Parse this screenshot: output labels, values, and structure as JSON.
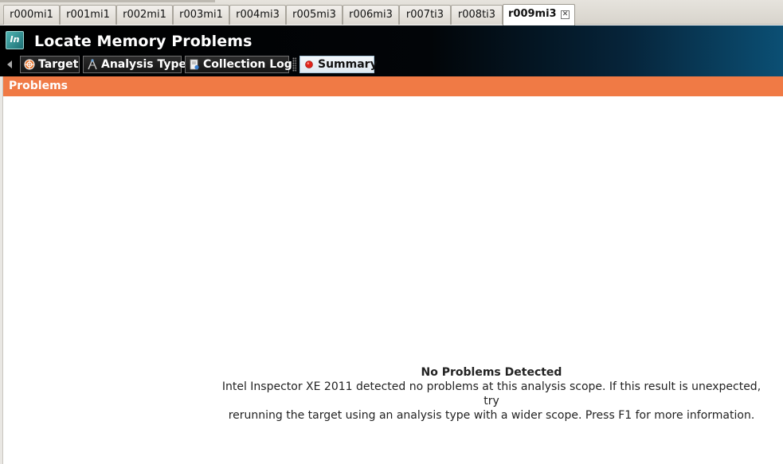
{
  "tabs": [
    {
      "label": "r000mi1"
    },
    {
      "label": "r001mi1"
    },
    {
      "label": "r002mi1"
    },
    {
      "label": "r003mi1"
    },
    {
      "label": "r004mi3"
    },
    {
      "label": "r005mi3"
    },
    {
      "label": "r006mi3"
    },
    {
      "label": "r007ti3"
    },
    {
      "label": "r008ti3"
    },
    {
      "label": "r009mi3",
      "active": true
    }
  ],
  "header": {
    "logo_text": "In",
    "title": "Locate Memory Problems"
  },
  "nav": {
    "items": [
      {
        "label": "Target",
        "icon": "target-icon"
      },
      {
        "label": "Analysis Type",
        "icon": "analysis-type-icon"
      },
      {
        "label": "Collection Log",
        "icon": "collection-log-icon"
      },
      {
        "label": "Summary",
        "icon": "red-dot-icon",
        "active": true
      }
    ]
  },
  "problems": {
    "heading": "Problems",
    "empty_title": "No Problems Detected",
    "empty_message_line1": "Intel Inspector XE 2011 detected no problems at this analysis scope. If this result is unexpected, try",
    "empty_message_line2": "rerunning the target using an analysis type with a wider scope. Press F1 for more information."
  },
  "colors": {
    "problems_bar": "#f07a45",
    "header_dark": "#000000",
    "header_blue": "#0b4f74"
  }
}
